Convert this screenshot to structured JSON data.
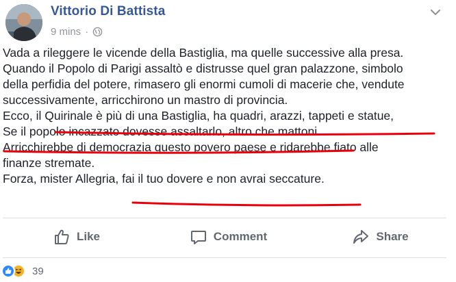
{
  "post": {
    "author": "Vittorio Di Battista",
    "time": "9 mins",
    "separator": "·",
    "lines": [
      "Vada a rileggere le vicende della Bastiglia, ma quelle successive alla presa.",
      "Quando il Popolo di Parigi assaltò e distrusse quel gran palazzone, simbolo",
      "della perfidia del potere, rimasero gli enormi cumoli di macerie che, vendute",
      "successivamente, arricchirono un mastro di provincia.",
      "Ecco, il Quirinale è più di una Bastiglia, ha quadri, arazzi, tappeti e statue,",
      "Se il popolo incazzato dovesse assaltarlo, altro che mattoni.",
      "Arricchirebbe di democrazia questo povero paese e ridarebbe fiato alle",
      "finanze stremate.",
      "Forza, mister Allegria, fai il tuo dovere e non avrai seccature."
    ]
  },
  "actions": {
    "like_label": "Like",
    "comment_label": "Comment",
    "share_label": "Share"
  },
  "reactions": {
    "count": "39",
    "types": [
      "like-icon",
      "haha-icon"
    ]
  },
  "annotations": {
    "underline_color": "#e8000b"
  },
  "colors": {
    "author": "#365899",
    "meta": "#90949c",
    "action_text": "#606770",
    "like_blue": "#2d88ff"
  }
}
